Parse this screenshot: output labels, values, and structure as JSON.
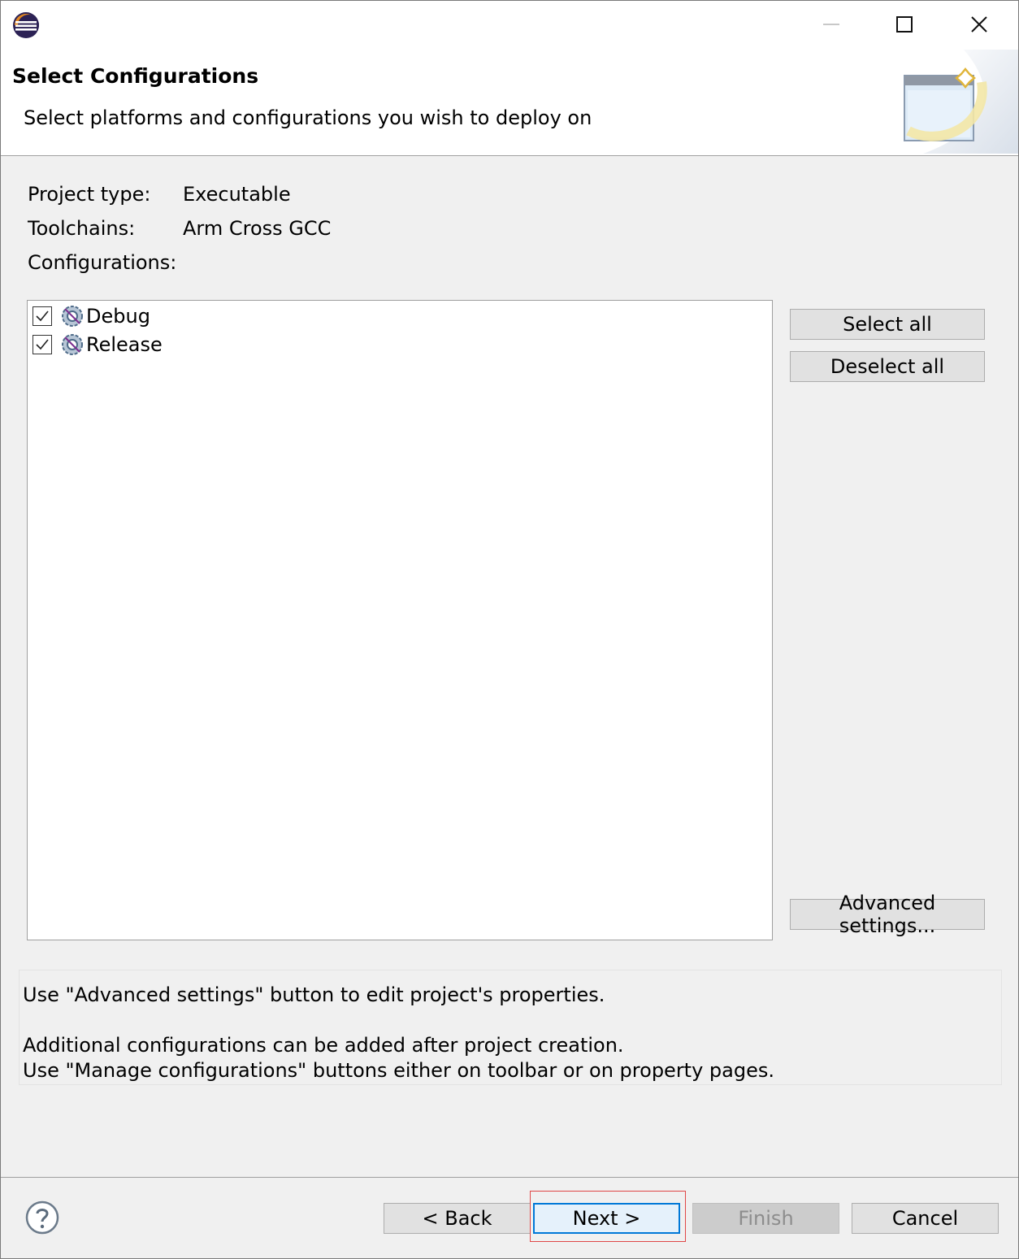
{
  "window": {
    "controls": {
      "minimize": "minimize-icon",
      "maximize": "maximize-icon",
      "close": "close-icon"
    }
  },
  "banner": {
    "title": "Select Configurations",
    "description": "Select platforms and configurations you wish to deploy on"
  },
  "info": {
    "project_type_label": "Project type:",
    "project_type_value": "Executable",
    "toolchains_label": "Toolchains:",
    "toolchains_value": "Arm Cross GCC",
    "configurations_label": "Configurations:"
  },
  "configurations": [
    {
      "label": "Debug",
      "checked": true
    },
    {
      "label": "Release",
      "checked": true
    }
  ],
  "side_buttons": {
    "select_all": "Select all",
    "deselect_all": "Deselect all",
    "advanced": "Advanced settings..."
  },
  "help_text": {
    "line1": "Use \"Advanced settings\" button to edit project's properties.",
    "line2": "Additional configurations can be added after project creation.",
    "line3": "Use \"Manage configurations\" buttons either on toolbar or on property pages."
  },
  "footer": {
    "back": "< Back",
    "next": "Next >",
    "finish": "Finish",
    "cancel": "Cancel"
  },
  "colors": {
    "accent": "#0078d7",
    "highlight": "#e04848",
    "dialog_bg": "#f0f0f0"
  }
}
